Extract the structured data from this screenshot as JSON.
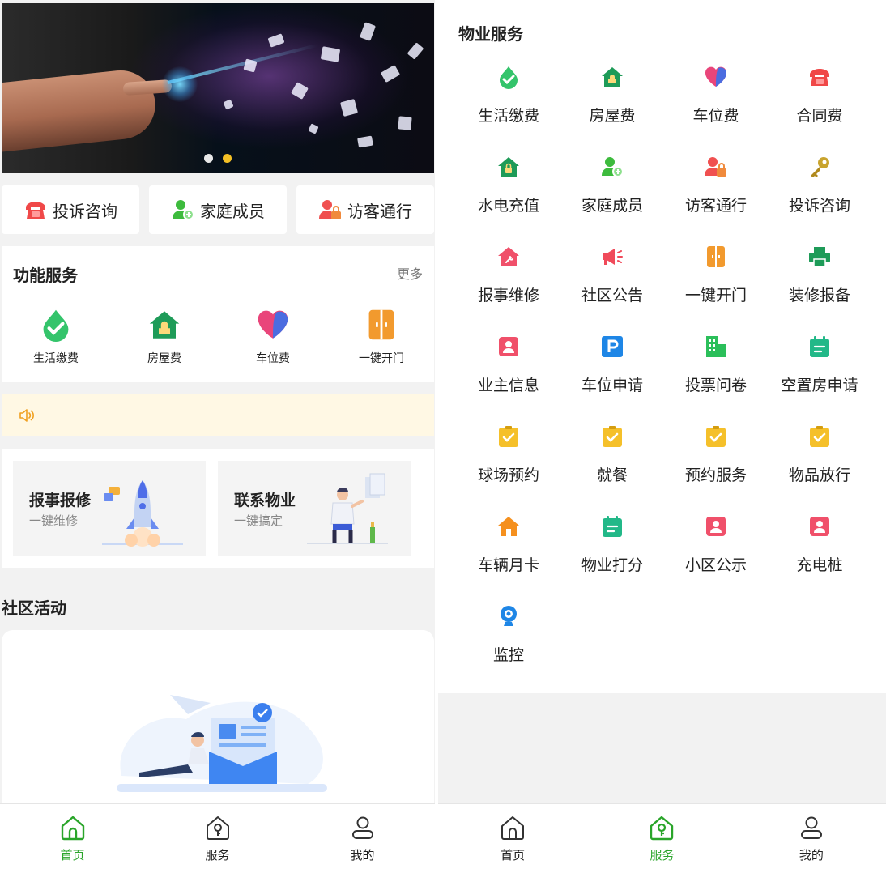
{
  "colors": {
    "accent_green": "#2aa52a",
    "notice_bg": "#fff8e4",
    "dot_active": "#f4c025"
  },
  "home": {
    "banner": {
      "dots": 2,
      "active_dot": 2
    },
    "quick_actions": [
      {
        "label": "投诉咨询",
        "icon": "phone-icon"
      },
      {
        "label": "家庭成员",
        "icon": "family-member-icon"
      },
      {
        "label": "访客通行",
        "icon": "visitor-lock-icon"
      }
    ],
    "function_section": {
      "title": "功能服务",
      "more": "更多",
      "items": [
        {
          "label": "生活缴费",
          "icon": "drop-check-icon"
        },
        {
          "label": "房屋费",
          "icon": "house-icon"
        },
        {
          "label": "车位费",
          "icon": "heart-icon"
        },
        {
          "label": "一键开门",
          "icon": "door-icon"
        }
      ]
    },
    "notice": {
      "icon": "speaker-icon"
    },
    "cards": [
      {
        "title": "报事报修",
        "subtitle": "一键维修",
        "icon": "rocket-illustration-icon"
      },
      {
        "title": "联系物业",
        "subtitle": "一键搞定",
        "icon": "person-illustration-icon"
      }
    ],
    "community": {
      "title": "社区活动"
    },
    "tabs": [
      {
        "label": "首页",
        "icon": "home-icon",
        "active": true
      },
      {
        "label": "服务",
        "icon": "service-house-icon",
        "active": false
      },
      {
        "label": "我的",
        "icon": "profile-icon",
        "active": false
      }
    ]
  },
  "service": {
    "title": "物业服务",
    "items": [
      {
        "label": "生活缴费",
        "icon": "drop-check-icon"
      },
      {
        "label": "房屋费",
        "icon": "house-icon"
      },
      {
        "label": "车位费",
        "icon": "heart-icon"
      },
      {
        "label": "合同费",
        "icon": "phone-icon"
      },
      {
        "label": "水电充值",
        "icon": "house-lock-icon"
      },
      {
        "label": "家庭成员",
        "icon": "family-member-icon"
      },
      {
        "label": "访客通行",
        "icon": "visitor-lock-icon"
      },
      {
        "label": "投诉咨询",
        "icon": "key-icon"
      },
      {
        "label": "报事维修",
        "icon": "repair-house-icon"
      },
      {
        "label": "社区公告",
        "icon": "megaphone-icon"
      },
      {
        "label": "一键开门",
        "icon": "door-icon"
      },
      {
        "label": "装修报备",
        "icon": "printer-icon"
      },
      {
        "label": "业主信息",
        "icon": "owner-card-icon"
      },
      {
        "label": "车位申请",
        "icon": "parking-icon"
      },
      {
        "label": "投票问卷",
        "icon": "building-icon"
      },
      {
        "label": "空置房申请",
        "icon": "calendar-icon"
      },
      {
        "label": "球场预约",
        "icon": "clipboard-check-icon"
      },
      {
        "label": "就餐",
        "icon": "clipboard-check-icon"
      },
      {
        "label": "预约服务",
        "icon": "clipboard-check-icon"
      },
      {
        "label": "物品放行",
        "icon": "clipboard-check-icon"
      },
      {
        "label": "车辆月卡",
        "icon": "orange-house-icon"
      },
      {
        "label": "物业打分",
        "icon": "calendar-icon"
      },
      {
        "label": "小区公示",
        "icon": "owner-card-icon"
      },
      {
        "label": "充电桩",
        "icon": "owner-card-icon"
      },
      {
        "label": "监控",
        "icon": "camera-icon"
      }
    ],
    "tabs": [
      {
        "label": "首页",
        "icon": "home-icon",
        "active": false
      },
      {
        "label": "服务",
        "icon": "service-house-icon",
        "active": true
      },
      {
        "label": "我的",
        "icon": "profile-icon",
        "active": false
      }
    ]
  }
}
